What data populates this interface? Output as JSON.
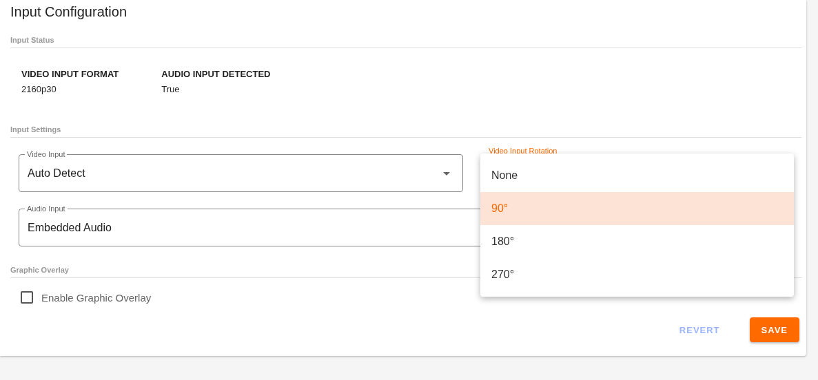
{
  "title": "Input Configuration",
  "status_section": {
    "heading": "Input Status",
    "items": [
      {
        "label": "VIDEO INPUT FORMAT",
        "value": "2160p30"
      },
      {
        "label": "AUDIO INPUT DETECTED",
        "value": "True"
      }
    ]
  },
  "settings_section": {
    "heading": "Input Settings",
    "fields": [
      {
        "label": "Video Input",
        "value": "Auto Detect",
        "kind": "select",
        "focused": false
      },
      {
        "label": "Video Input Rotation",
        "kind": "select",
        "focused": true
      },
      {
        "label": "Audio Input",
        "value": "Embedded Audio",
        "kind": "text",
        "focused": false
      }
    ]
  },
  "rotation_menu": {
    "options": [
      {
        "label": "None",
        "selected": false
      },
      {
        "label": "90°",
        "selected": true
      },
      {
        "label": "180°",
        "selected": false
      },
      {
        "label": "270°",
        "selected": false
      }
    ]
  },
  "overlay_section": {
    "heading": "Graphic Overlay",
    "checkbox": {
      "label": "Enable Graphic Overlay",
      "checked": false
    }
  },
  "buttons": [
    {
      "label": "REVERT",
      "kind": "text",
      "disabled": true
    },
    {
      "label": "SAVE",
      "kind": "primary",
      "disabled": false
    }
  ]
}
